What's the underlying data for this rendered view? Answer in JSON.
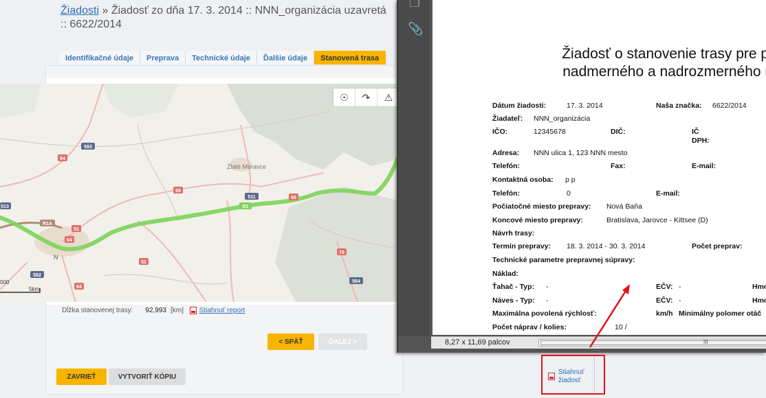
{
  "header": {
    "breadcrumb_link": "Žiadosti",
    "title_rest": " » Žiadosť zo dňa 17. 3. 2014 :: NNN_organizácia uzavretá :: 6622/2014"
  },
  "tabs": [
    {
      "label": "Identifikačné údaje"
    },
    {
      "label": "Preprava"
    },
    {
      "label": "Technické údaje"
    },
    {
      "label": "Ďalšie údaje"
    },
    {
      "label": "Stanovená trasa"
    }
  ],
  "map": {
    "labels": {
      "city": "Zlaté Moravce",
      "r1": "R1",
      "r1a": "R1A",
      "road_593": "593",
      "road_64a": "64",
      "road_65": "65",
      "road_511": "511",
      "road_65b": "65",
      "road_51": "51",
      "road_64b": "64",
      "road_51b": "51",
      "road_76": "76",
      "road_564": "564",
      "road_582": "582",
      "road_513": "513",
      "road_64c": "64",
      "scale_km": "5km",
      "scale_left": "000",
      "city_n": "N"
    }
  },
  "route": {
    "length_label": "Dĺžka stanovenej trasy:",
    "length_value": "92,993",
    "length_unit": "[km]",
    "report_link": "Stiahnuť report"
  },
  "buttons": {
    "back": "< SPÄŤ",
    "next": "ĎALEJ >",
    "close": "ZAVRIEŤ",
    "copy": "VYTVORIŤ KÓPIU"
  },
  "pdf": {
    "heading_line1": "Žiadosť o stanovenie trasy pre pre",
    "heading_line2": "nadmerného a nadrozmerného ná",
    "fields": {
      "datum_label": "Dátum žiadosti:",
      "datum_value": "17. 3. 2014",
      "znacka_label": "Naša značka:",
      "znacka_value": "6622/2014",
      "ziadatel_label": "Žiadateľ:",
      "ziadatel_value": "NNN_organizácia",
      "ico_label": "IČO:",
      "ico_value": "12345678",
      "dic_label": "DIČ:",
      "icdph_label1": "IČ",
      "icdph_label2": "DPH:",
      "adresa_label": "Adresa:",
      "adresa_value": "NNN ulica 1, 123 NNN mesto",
      "telefon_label": "Telefón:",
      "fax_label": "Fax:",
      "email_label": "E-mail:",
      "kontakt_label": "Kontaktná osoba:",
      "kontakt_value": "p p",
      "telefon2_label": "Telefón:",
      "telefon2_value": "0",
      "email2_label": "E-mail:",
      "start_label": "Počiatočné miesto prepravy:",
      "start_value": "Nová Baňa",
      "end_label": "Koncové miesto prepravy:",
      "end_value": "Bratislava, Jarovce - Kittsee (D)",
      "navrh_label": "Návrh trasy:",
      "termin_label": "Termín prepravy:",
      "termin_value": "18. 3. 2014 - 30. 3. 2014",
      "pocet_label": "Počet preprav:",
      "tech_label": "Technické parametre prepravnej súpravy:",
      "naklad_label": "Náklad:",
      "tahac_label": "Ťahač - Typ:",
      "tahac_value": "-",
      "ecv1_label": "EČV:",
      "ecv1_value": "-",
      "hmo1": "Hmo",
      "naves_label": "Náves - Typ:",
      "naves_value": "-",
      "ecv2_label": "EČV:",
      "ecv2_value": "-",
      "hmo2": "Hmo",
      "rychlost_label": "Maximálna povolená rýchlosť:",
      "rychlost_unit": "km/h",
      "polomer_label": "Minimálny polomer otáč",
      "napravy_label": "Počet náprav / kolies:",
      "napravy_value": "10 /"
    },
    "status_size": "8,27 x 11,69 palcov",
    "scroll_grip": "III"
  },
  "download": {
    "line1": "Stiahnuť",
    "line2": "žiadosť"
  },
  "colors": {
    "accent": "#f7b500",
    "route": "#7dd35a",
    "highlight": "#e0121a",
    "link": "#2f6fb0"
  }
}
